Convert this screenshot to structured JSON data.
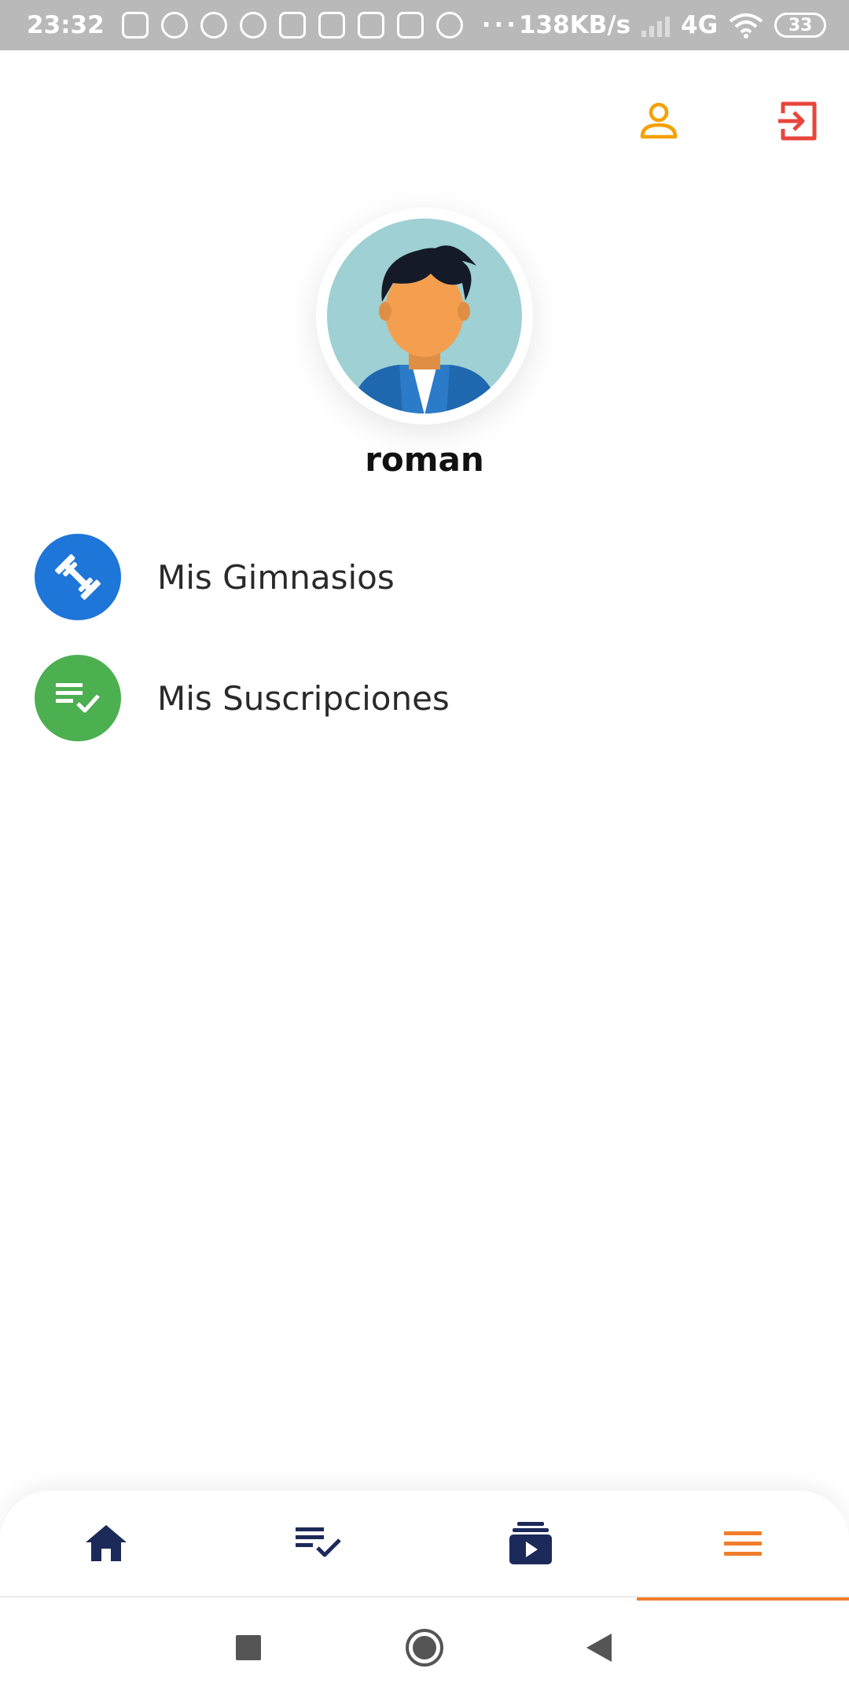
{
  "status_bar": {
    "time": "23:32",
    "network_speed": "138KB/s",
    "network_type": "4G",
    "battery": "33"
  },
  "header": {
    "profile_icon": "person-outline-icon",
    "logout_icon": "logout-icon"
  },
  "user": {
    "name": "roman"
  },
  "menu": {
    "items": [
      {
        "label": "Mis Gimnasios",
        "icon": "dumbbell-icon",
        "color": "#1e76d9"
      },
      {
        "label": "Mis Suscripciones",
        "icon": "playlist-check-icon",
        "color": "#4caf50"
      }
    ]
  },
  "bottom_nav": {
    "active_index": 3,
    "tabs": [
      {
        "icon": "home-icon"
      },
      {
        "icon": "playlist-check-icon"
      },
      {
        "icon": "video-library-icon"
      },
      {
        "icon": "menu-icon"
      }
    ]
  },
  "colors": {
    "accent_orange": "#f07d2a",
    "logout_red": "#e8453c",
    "profile_orange": "#f5a000",
    "nav_navy": "#1c2a5a",
    "status_bar_bg": "#b9b9b9"
  }
}
